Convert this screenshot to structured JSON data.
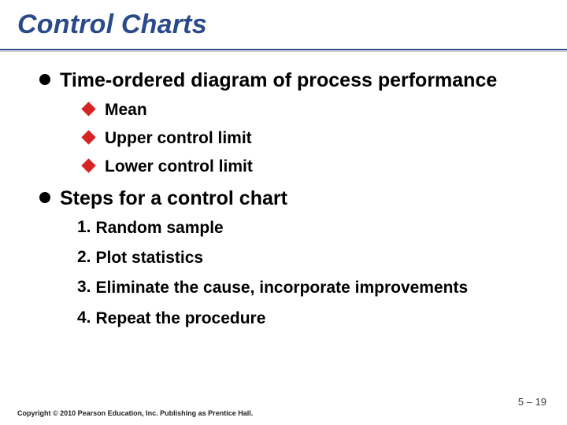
{
  "title": "Control Charts",
  "bullets": [
    {
      "text": "Time-ordered diagram of process performance",
      "sub": [
        "Mean",
        "Upper control limit",
        "Lower control limit"
      ]
    },
    {
      "text": "Steps for a control chart",
      "steps": [
        "Random sample",
        "Plot statistics",
        "Eliminate the cause, incorporate improvements",
        "Repeat the procedure"
      ]
    }
  ],
  "page_number": "5 – 19",
  "copyright": "Copyright © 2010 Pearson Education, Inc. Publishing as Prentice Hall."
}
